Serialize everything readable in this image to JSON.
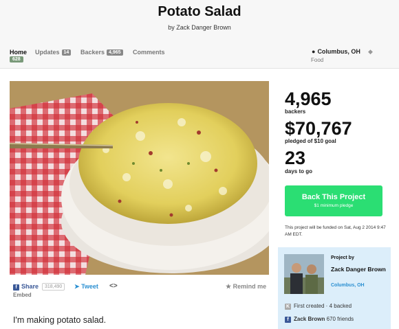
{
  "project": {
    "title": "Potato Salad",
    "byline": "by Zack Danger Brown"
  },
  "nav": {
    "home": "Home",
    "home_count": "628",
    "updates": "Updates",
    "updates_count": "14",
    "backers": "Backers",
    "backers_count": "4,965",
    "comments": "Comments",
    "location": "Columbus, OH",
    "category": "Food"
  },
  "stats": {
    "backers_value": "4,965",
    "backers_label": "backers",
    "pledged_value": "$70,767",
    "pledged_label": "pledged of $10 goal",
    "days_value": "23",
    "days_label": "days to go"
  },
  "cta": {
    "label": "Back This Project",
    "sublabel": "$1 minimum pledge"
  },
  "funding_note": "This project will be funded on Sat, Aug 2 2014 9:47 AM EDT.",
  "creator": {
    "heading": "Project by",
    "name": "Zack Danger Brown",
    "location": "Columbus, OH",
    "created": "First created · 4 backed",
    "facebook_name": "Zack Brown",
    "facebook_friends": "670 friends"
  },
  "share": {
    "share_label": "Share",
    "share_count": "318,490",
    "tweet_label": "Tweet",
    "embed_symbol": "<>",
    "embed_label": "Embed",
    "remind_label": "Remind me"
  },
  "description": "I'm making potato salad.",
  "colors": {
    "accent_green": "#2bde73",
    "link_blue": "#2a8fd1",
    "facebook_blue": "#3b5998",
    "creator_panel": "#dceefa"
  }
}
